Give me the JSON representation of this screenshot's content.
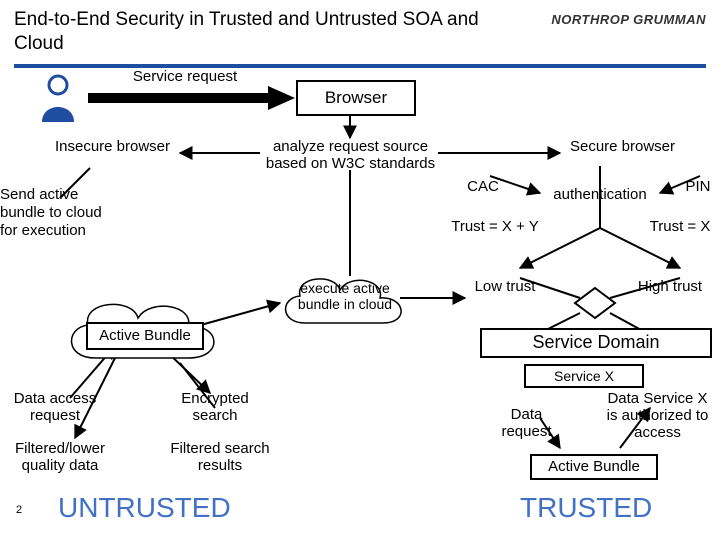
{
  "title": "End-to-End Security in Trusted and Untrusted SOA and Cloud",
  "logo": "NORTHROP GRUMMAN",
  "labels": {
    "service_request": "Service request",
    "browser": "Browser",
    "insecure_browser": "Insecure browser",
    "analyze": "analyze request source based on W3C standards",
    "secure_browser": "Secure browser",
    "send_active": "Send active bundle to cloud for execution",
    "cac": "CAC",
    "authentication": "authentication",
    "pin": "PIN",
    "trust_xy": "Trust = X + Y",
    "trust_x": "Trust = X",
    "execute": "execute active bundle in cloud",
    "low_trust": "Low trust",
    "high_trust": "High trust",
    "active_bundle": "Active Bundle",
    "service_domain": "Service Domain",
    "service_x": "Service X",
    "data_access_request": "Data access request",
    "encrypted_search": "Encrypted search",
    "filtered_lower": "Filtered/lower quality data",
    "filtered_results": "Filtered search results",
    "data_request": "Data request",
    "data_service_auth": "Data Service X is authorized to access",
    "active_bundle2": "Active Bundle",
    "untrusted": "UNTRUSTED",
    "trusted": "TRUSTED",
    "slide_num": "2"
  }
}
